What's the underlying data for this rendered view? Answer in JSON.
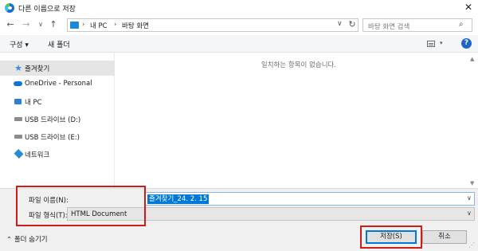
{
  "window": {
    "title": "다른 이름으로 저장",
    "close_glyph": "✕"
  },
  "nav": {
    "back": "←",
    "forward": "→",
    "recent": "∨",
    "up": "↑"
  },
  "address": {
    "breadcrumb": [
      "내 PC",
      "바탕 화면"
    ],
    "separator": "›",
    "dropdown": "∨",
    "refresh": "↻"
  },
  "search": {
    "placeholder": "바탕 화면 검색"
  },
  "toolbar": {
    "organize_label": "구성 ▾",
    "new_folder_label": "새 폴더",
    "help_label": "?"
  },
  "sidebar": {
    "items": [
      {
        "label": "즐겨찾기",
        "icon": "star-icon",
        "selected": true
      },
      {
        "label": "OneDrive - Personal",
        "icon": "cloud-icon"
      },
      {
        "label": "내 PC",
        "icon": "pc-icon"
      },
      {
        "label": "USB 드라이브 (D:)",
        "icon": "drive-icon"
      },
      {
        "label": "USB 드라이브 (E:)",
        "icon": "drive-icon"
      },
      {
        "label": "네트워크",
        "icon": "network-icon"
      }
    ]
  },
  "content": {
    "empty_message": "일치하는 항목이 없습니다."
  },
  "form": {
    "filename_label": "파일 이름(N):",
    "filename_value": "즐겨찾기_24. 2. 15",
    "filetype_label": "파일 형식(T):",
    "filetype_value": "HTML Document"
  },
  "footer": {
    "hide_folders": "⌃ 폴더 숨기기",
    "save_label": "저장(S)",
    "cancel_label": "취소"
  },
  "colors": {
    "accent": "#0078d7",
    "highlight_box": "#d11a1a"
  }
}
